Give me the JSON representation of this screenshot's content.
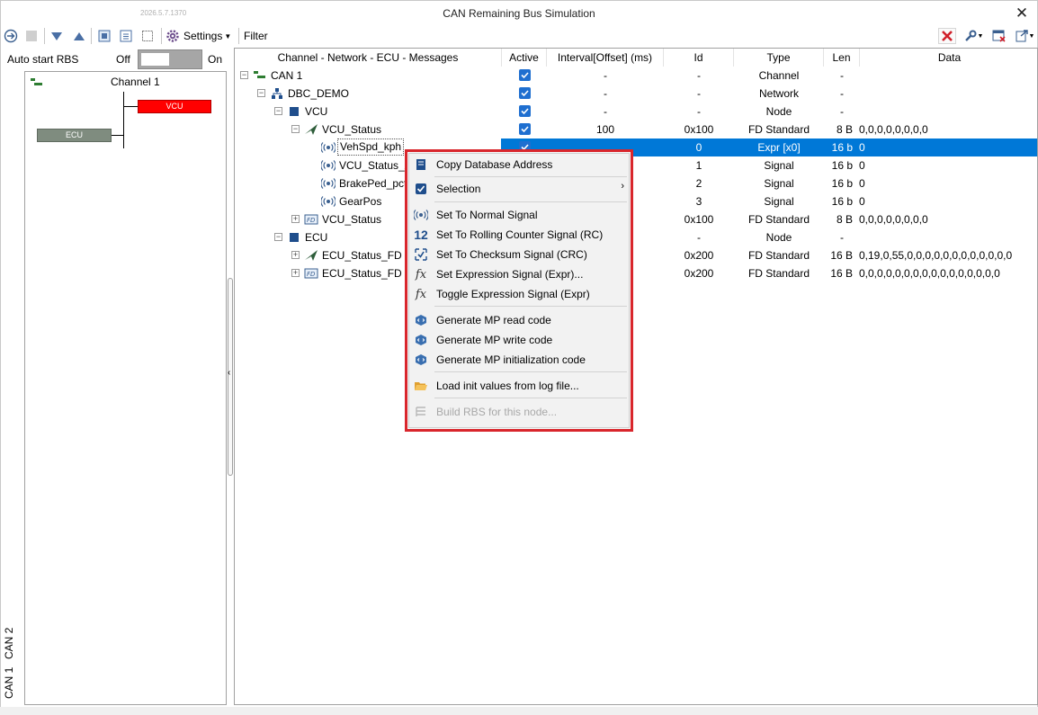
{
  "window": {
    "build": "2026.5.7.1370",
    "title": "CAN Remaining Bus Simulation",
    "close_glyph": "✕"
  },
  "toolbar": {
    "settings_label": "Settings",
    "filter_label": "Filter"
  },
  "autostart": {
    "label": "Auto start RBS",
    "off_label": "Off",
    "on_label": "On",
    "state": "off"
  },
  "diagram": {
    "channel_label": "Channel 1",
    "vcu_label": "VCU",
    "ecu_label": "ECU",
    "vcu_color": "#ff0000",
    "ecu_color": "#7f8c7f"
  },
  "vtabs": [
    "CAN 2",
    "CAN 1"
  ],
  "columns": [
    "Channel - Network - ECU - Messages",
    "Active",
    "Interval[Offset] (ms)",
    "Id",
    "Type",
    "Len",
    "Data"
  ],
  "rows": [
    {
      "name": "CAN 1",
      "icon": "channel-icon",
      "active": true,
      "interval": "-",
      "id": "-",
      "type": "Channel",
      "len": "-",
      "data": ""
    },
    {
      "name": "DBC_DEMO",
      "icon": "network-icon",
      "active": true,
      "interval": "-",
      "id": "-",
      "type": "Network",
      "len": "-",
      "data": ""
    },
    {
      "name": "VCU",
      "icon": "node-icon",
      "active": true,
      "interval": "-",
      "id": "-",
      "type": "Node",
      "len": "-",
      "data": ""
    },
    {
      "name": "VCU_Status",
      "icon": "tx-message-icon",
      "active": true,
      "interval": "100",
      "id": "0x100",
      "type": "FD Standard",
      "len": "8 B",
      "data": "0,0,0,0,0,0,0,0"
    },
    {
      "name": "VehSpd_kph",
      "icon": "signal-icon",
      "active": true,
      "interval": "",
      "id": "0",
      "type": "Expr [x0]",
      "len": "16 b",
      "data": "0"
    },
    {
      "name": "VCU_Status_A",
      "icon": "signal-icon",
      "active": false,
      "interval": "",
      "id": "1",
      "type": "Signal",
      "len": "16 b",
      "data": "0"
    },
    {
      "name": "BrakePed_pct",
      "icon": "signal-icon",
      "active": false,
      "interval": "",
      "id": "2",
      "type": "Signal",
      "len": "16 b",
      "data": "0"
    },
    {
      "name": "GearPos",
      "icon": "signal-icon",
      "active": false,
      "interval": "",
      "id": "3",
      "type": "Signal",
      "len": "16 b",
      "data": "0"
    },
    {
      "name": "VCU_Status",
      "icon": "rx-fd-message-icon",
      "active": false,
      "interval": "",
      "id": "0x100",
      "type": "FD Standard",
      "len": "8 B",
      "data": "0,0,0,0,0,0,0,0"
    },
    {
      "name": "ECU",
      "icon": "node-icon",
      "active": false,
      "interval": "",
      "id": "-",
      "type": "Node",
      "len": "-",
      "data": ""
    },
    {
      "name": "ECU_Status_FD",
      "icon": "tx-message-icon",
      "active": false,
      "interval": "",
      "id": "0x200",
      "type": "FD Standard",
      "len": "16 B",
      "data": "0,19,0,55,0,0,0,0,0,0,0,0,0,0,0,0"
    },
    {
      "name": "ECU_Status_FD",
      "icon": "rx-fd-message-icon",
      "active": false,
      "interval": "",
      "id": "0x200",
      "type": "FD Standard",
      "len": "16 B",
      "data": "0,0,0,0,0,0,0,0,0,0,0,0,0,0,0,0"
    }
  ],
  "context_menu": {
    "items": [
      {
        "label": "Copy Database Address",
        "icon": "database-icon"
      },
      {
        "label": "Selection",
        "icon": "checkbox-icon",
        "submenu": "›"
      },
      {
        "label": "Set To Normal Signal",
        "icon": "signal-icon"
      },
      {
        "label": "Set To Rolling Counter Signal (RC)",
        "icon": "number-12-icon"
      },
      {
        "label": "Set To Checksum Signal (CRC)",
        "icon": "checksum-icon"
      },
      {
        "label": "Set Expression Signal (Expr)...",
        "icon": "function-icon"
      },
      {
        "label": "Toggle Expression Signal (Expr)",
        "icon": "function-icon"
      },
      {
        "label": "Generate MP read code",
        "icon": "code-cube-icon"
      },
      {
        "label": "Generate MP write code",
        "icon": "code-cube-icon"
      },
      {
        "label": "Generate MP initialization code",
        "icon": "code-cube-icon"
      },
      {
        "label": "Load init values from log file...",
        "icon": "folder-open-icon"
      },
      {
        "label": "Build RBS for this node...",
        "icon": "build-icon",
        "disabled": true
      }
    ]
  }
}
